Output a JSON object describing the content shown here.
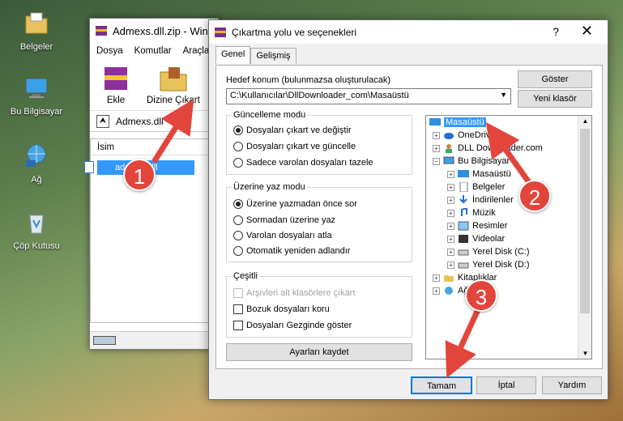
{
  "desktop": {
    "icons": [
      {
        "label": "Belgeler",
        "icon": "folder-icon"
      },
      {
        "label": "Bu Bilgisayar",
        "icon": "computer-icon"
      },
      {
        "label": "Ağ",
        "icon": "network-icon"
      },
      {
        "label": "Çöp Kutusu",
        "icon": "recycle-bin-icon"
      }
    ]
  },
  "bgwindow": {
    "title": "Admexs.dll.zip - Win",
    "menu": [
      "Dosya",
      "Komutlar",
      "Araçla"
    ],
    "tools": {
      "add": "Ekle",
      "extract": "Dizine Çıkart"
    },
    "address": "Admexs.dll",
    "list_header": "İsim",
    "file": "admexs.dll"
  },
  "dialog": {
    "title": "Çıkartma yolu ve seçenekleri",
    "help": "?",
    "close": "✕",
    "tabs": [
      "Genel",
      "Gelişmiş"
    ],
    "dest_label": "Hedef konum (bulunmazsa oluşturulacak)",
    "dest_value": "C:\\Kullanıcılar\\DllDownloader_com\\Masaüstü",
    "show_btn": "Göster",
    "new_folder_btn": "Yeni klasör",
    "update_group": {
      "title": "Güncelleme modu",
      "options": [
        "Dosyaları çıkart ve değiştir",
        "Dosyaları çıkart ve güncelle",
        "Sadece varolan dosyaları tazele"
      ],
      "selected": 0
    },
    "overwrite_group": {
      "title": "Üzerine yaz modu",
      "options": [
        "Üzerine yazmadan önce sor",
        "Sormadan üzerine yaz",
        "Varolan dosyaları atla",
        "Otomatik yeniden adlandır"
      ],
      "selected": 0
    },
    "misc_group": {
      "title": "Çeşitli",
      "options": [
        "Arşivleri alt klasörlere çıkart",
        "Bozuk dosyaları koru",
        "Dosyaları Gezginde göster"
      ]
    },
    "save_btn": "Ayarları kaydet",
    "tree": [
      {
        "label": "Masaüstü",
        "icon": "desktop-icon",
        "selected": true
      },
      {
        "label": "OneDrive",
        "icon": "cloud-icon"
      },
      {
        "label": "DLL Downloader.com",
        "icon": "user-icon"
      },
      {
        "label": "Bu Bilgisayar",
        "icon": "computer-icon"
      },
      {
        "label": "Masaüstü",
        "icon": "desktop-icon"
      },
      {
        "label": "Belgeler",
        "icon": "document-icon"
      },
      {
        "label": "İndirilenler",
        "icon": "download-icon"
      },
      {
        "label": "Müzik",
        "icon": "music-icon"
      },
      {
        "label": "Resimler",
        "icon": "picture-icon"
      },
      {
        "label": "Videolar",
        "icon": "video-icon"
      },
      {
        "label": "Yerel Disk (C:)",
        "icon": "drive-icon"
      },
      {
        "label": "Yerel Disk (D:)",
        "icon": "drive-icon"
      },
      {
        "label": "Kitaplıklar",
        "icon": "library-icon"
      },
      {
        "label": "Ağ",
        "icon": "network-icon"
      }
    ],
    "ok_btn": "Tamam",
    "cancel_btn": "İptal",
    "help_btn": "Yardım"
  },
  "callouts": [
    "1",
    "2",
    "3"
  ],
  "colors": {
    "selection": "#3399ff",
    "callout": "#e2453c"
  }
}
